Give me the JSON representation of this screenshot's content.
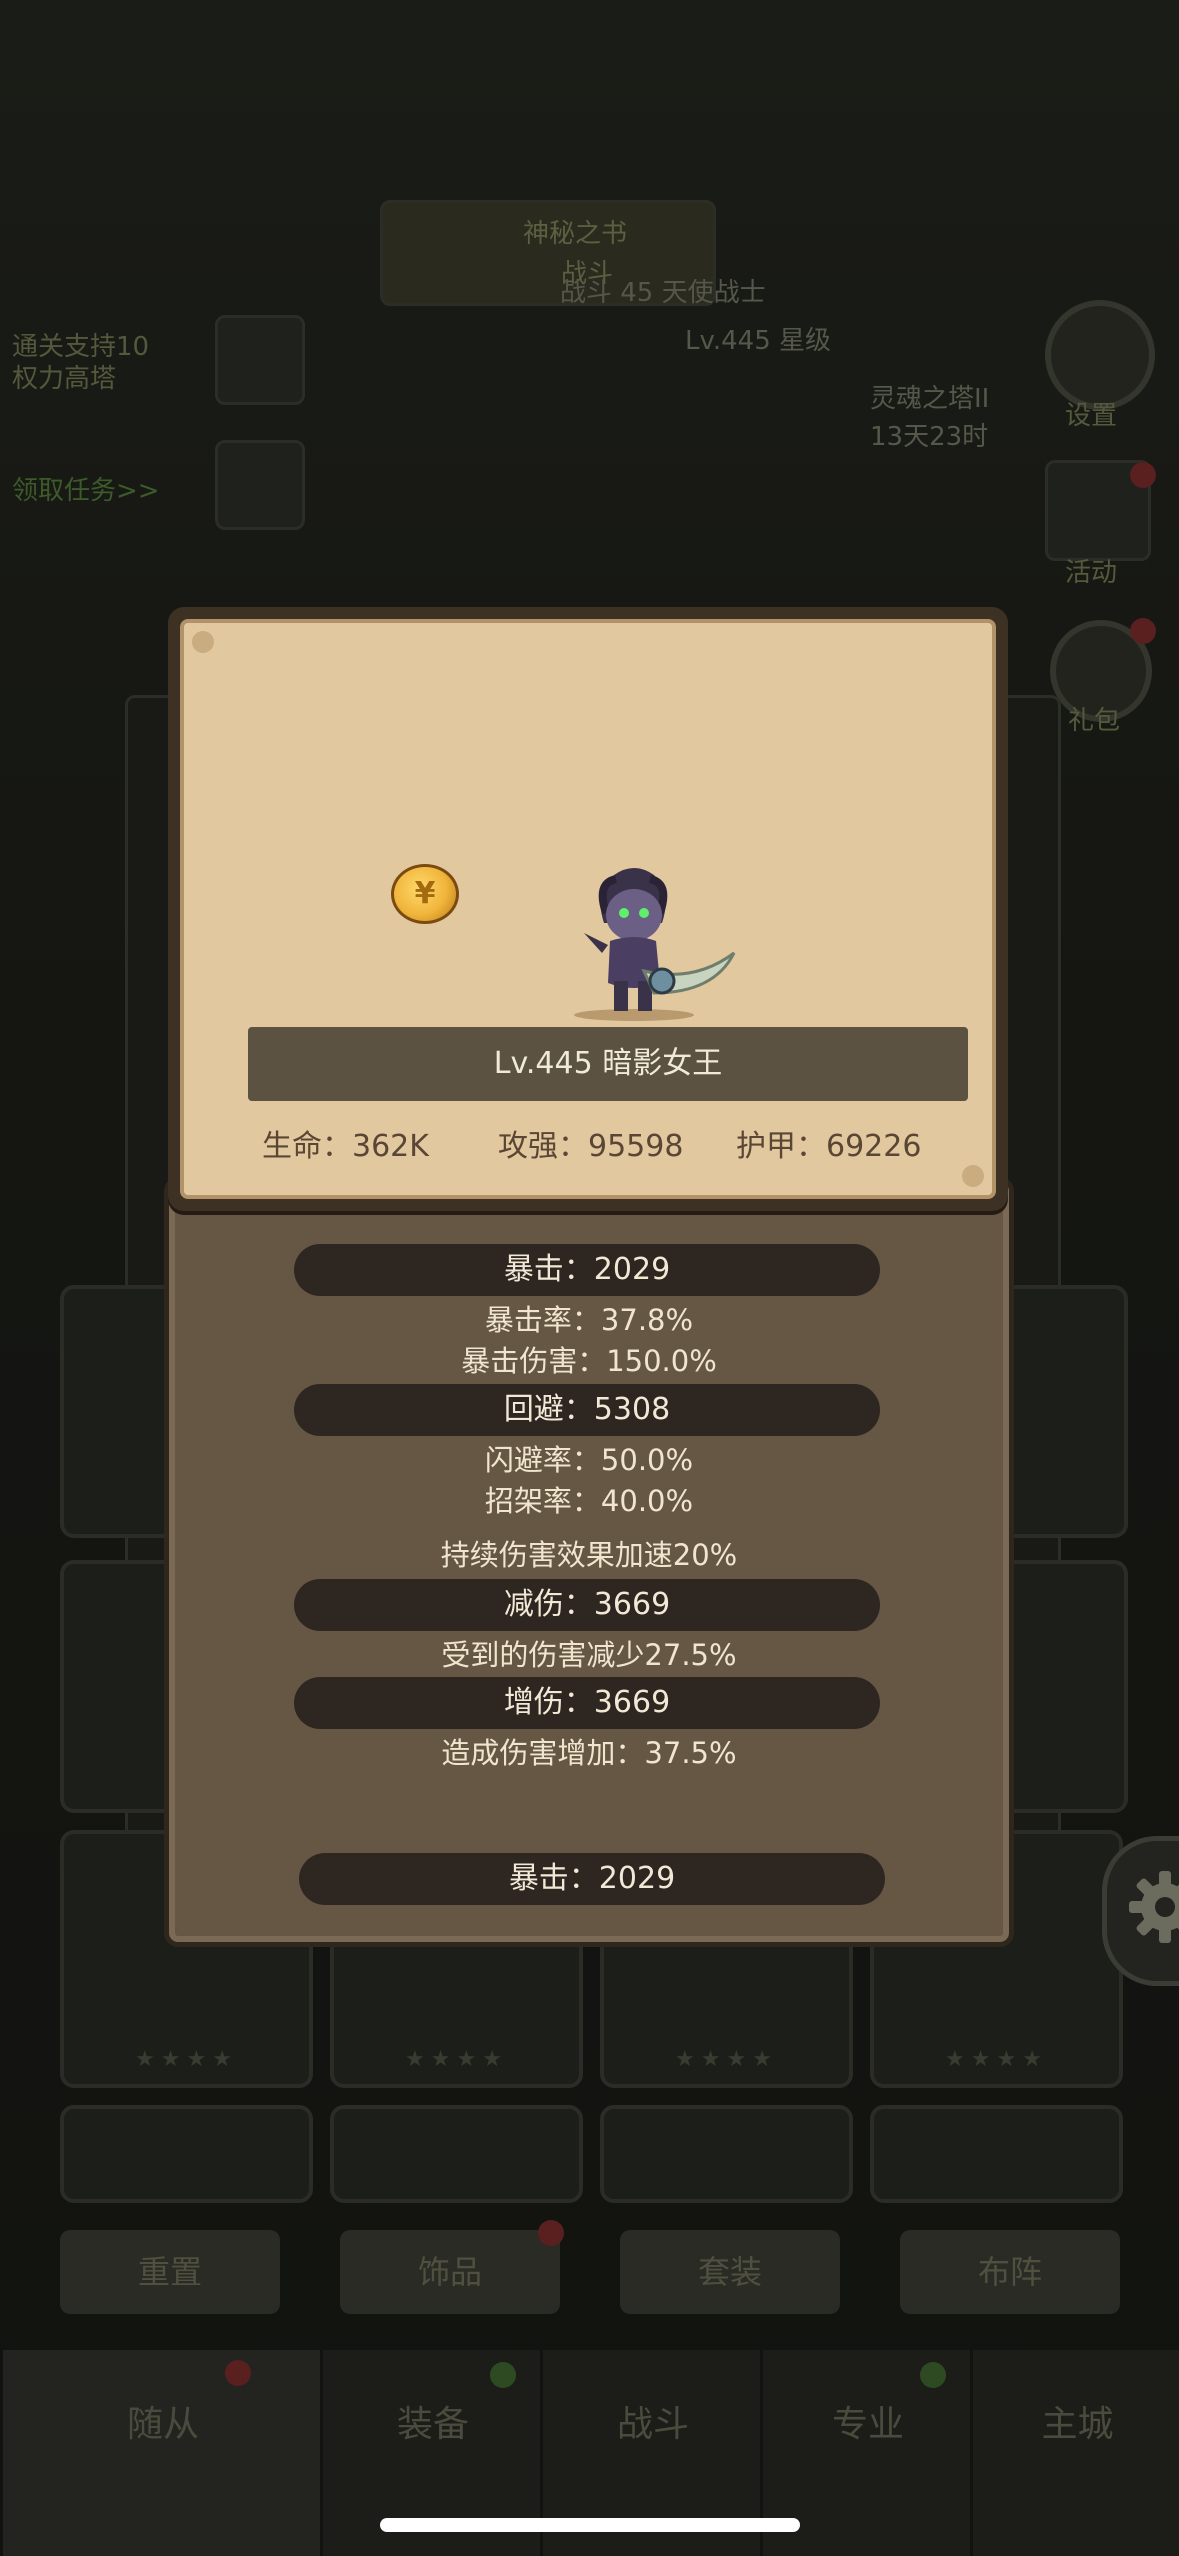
{
  "background": {
    "top_banner_label": "神秘之书",
    "banner_sub": "战斗",
    "hero_line": "战斗 45 天使战士",
    "level_line": "Lv.445 星级",
    "quest_line1": "通关支持10",
    "quest_line2": "权力高塔",
    "claim_text": "领取任务>>",
    "timer_title": "灵魂之塔II",
    "timer_value": "13天23时",
    "side_settings": "设置",
    "side_activity": "活动",
    "side_gift": "礼包",
    "buttons": [
      "重置",
      "饰品",
      "套装",
      "布阵"
    ],
    "nav": [
      "随从",
      "装备",
      "战斗",
      "专业",
      "主城"
    ],
    "stars": "★★★★"
  },
  "popup": {
    "name_bar": "Lv.445 暗影女王",
    "hp": "生命：362K",
    "attack": "攻强：95598",
    "armor": "护甲：69226",
    "crit": "暴击：2029",
    "crit_rate": "暴击率：37.8%",
    "crit_damage": "暴击伤害：150.0%",
    "dodge": "回避：5308",
    "dodge_rate": "闪避率：50.0%",
    "parry_rate": "招架率：40.0%",
    "dot_bonus": "持续伤害效果加速20%",
    "damage_reduction": "减伤：3669",
    "damage_taken_reduced": "受到的伤害减少27.5%",
    "damage_increase": "增伤：3669",
    "damage_dealt_increase": "造成伤害增加：37.5%"
  },
  "icons": {
    "coin": "coin-icon",
    "character": "shadow-queen-icon",
    "gear": "gear-icon"
  },
  "colors": {
    "card_paper": "#e2c89f",
    "panel": "#665745",
    "attr_bar": "#2e2620"
  }
}
